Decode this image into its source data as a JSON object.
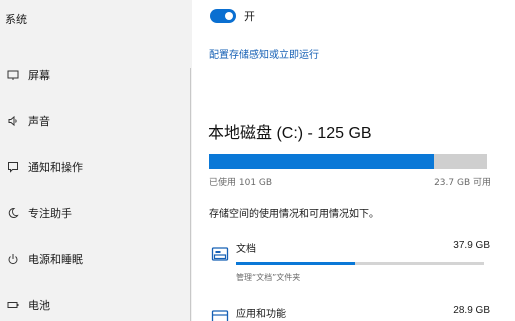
{
  "sidebar": {
    "title": "系统",
    "items": [
      {
        "label": "屏幕",
        "icon": "monitor-icon"
      },
      {
        "label": "声音",
        "icon": "speaker-icon"
      },
      {
        "label": "通知和操作",
        "icon": "notification-icon"
      },
      {
        "label": "专注助手",
        "icon": "moon-icon"
      },
      {
        "label": "电源和睡眠",
        "icon": "power-icon"
      },
      {
        "label": "电池",
        "icon": "battery-icon"
      }
    ]
  },
  "storage_sense": {
    "toggle_state": "on",
    "toggle_label": "开",
    "config_link": "配置存储感知或立即运行"
  },
  "drive": {
    "title": "本地磁盘 (C:) - 125 GB",
    "used_label": "已使用 101 GB",
    "free_label": "23.7 GB 可用",
    "used_fraction": 0.81,
    "description": "存储空间的使用情况和可用情况如下。"
  },
  "categories": [
    {
      "name": "文档",
      "size": "37.9 GB",
      "sub": "管理“文档”文件夹",
      "usage_fraction": 0.48,
      "icon": "documents-icon"
    },
    {
      "name": "应用和功能",
      "size": "28.9 GB",
      "icon": "apps-icon"
    }
  ],
  "colors": {
    "accent": "#0a78d7",
    "link": "#1660b5",
    "sidebar_bg": "#f2f2f2"
  }
}
